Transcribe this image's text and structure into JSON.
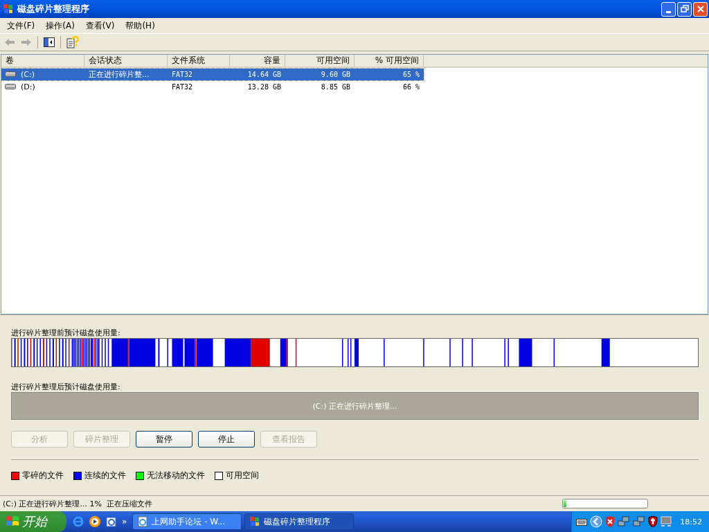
{
  "window": {
    "title": "磁盘碎片整理程序"
  },
  "menu": [
    "文件(F)",
    "操作(A)",
    "查看(V)",
    "帮助(H)"
  ],
  "table": {
    "columns": [
      "卷",
      "会话状态",
      "文件系统",
      "容量",
      "可用空间",
      "% 可用空间"
    ],
    "rows": [
      {
        "volume": "(C:)",
        "status": "正在进行碎片整...",
        "fs": "FAT32",
        "capacity": "14.64 GB",
        "free": "9.60 GB",
        "pct": "65 %",
        "selected": true
      },
      {
        "volume": "(D:)",
        "status": "",
        "fs": "FAT32",
        "capacity": "13.28 GB",
        "free": "8.85 GB",
        "pct": "66 %",
        "selected": false
      }
    ]
  },
  "before_label": "进行碎片整理前预计磁盘使用量:",
  "after_label": "进行碎片整理后预计磁盘使用量:",
  "after_message": "(C:) 正在进行碎片整理...",
  "buttons": [
    {
      "label": "分析",
      "disabled": true
    },
    {
      "label": "碎片整理",
      "disabled": true
    },
    {
      "label": "暂停",
      "disabled": false
    },
    {
      "label": "停止",
      "disabled": false
    },
    {
      "label": "查看报告",
      "disabled": true
    }
  ],
  "legend": [
    {
      "label": "零碎的文件",
      "color": "#ff0000"
    },
    {
      "label": "连续的文件",
      "color": "#0000ff"
    },
    {
      "label": "无法移动的文件",
      "color": "#00ff00"
    },
    {
      "label": "可用空间",
      "color": "#ffffff"
    }
  ],
  "status_bar": {
    "text": "(C:) 正在进行碎片整理... 1%  正在压缩文件",
    "level": 0.03
  },
  "taskbar": {
    "start": "开始",
    "quick_launch_more": "»",
    "tasks": [
      {
        "kind": "browser",
        "label": "上网助手论坛 - W...",
        "selected": false
      },
      {
        "kind": "defrag",
        "label": "磁盘碎片整理程序",
        "selected": true
      }
    ],
    "clock": "18:52"
  }
}
